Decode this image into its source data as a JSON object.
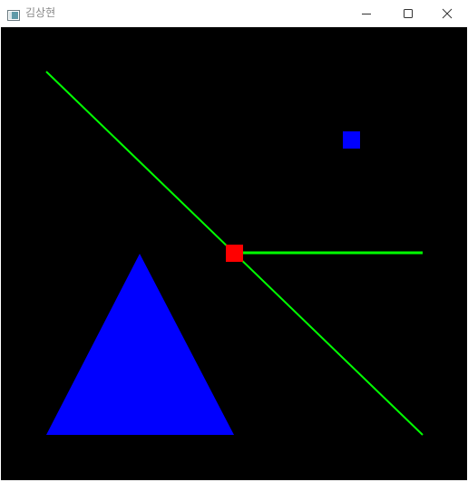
{
  "window": {
    "title": "김상현",
    "icon": "app-window-icon",
    "controls": [
      "minimize-icon",
      "maximize-icon",
      "close-icon"
    ]
  },
  "canvas": {
    "background": "#000000",
    "shapes": [
      {
        "type": "line",
        "name": "diagonal-line",
        "color": "#00ff00"
      },
      {
        "type": "line",
        "name": "horizontal-line",
        "color": "#00ff00"
      },
      {
        "type": "rect",
        "name": "red-square",
        "color": "#ff0000"
      },
      {
        "type": "rect",
        "name": "blue-square",
        "color": "#0000ff"
      },
      {
        "type": "triangle",
        "name": "blue-triangle",
        "color": "#0000ff"
      }
    ]
  }
}
